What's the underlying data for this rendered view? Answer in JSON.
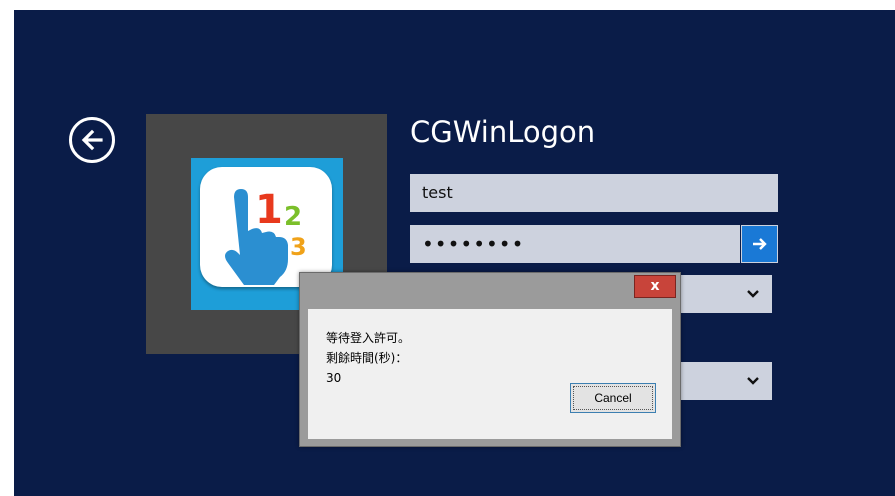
{
  "login": {
    "title": "CGWinLogon",
    "username_value": "test",
    "password_masked": "••••••••"
  },
  "icons": {
    "back": "back-arrow-icon",
    "submit": "arrow-right-icon",
    "dropdown": "chevron-down-icon",
    "app": "hand-123-app-icon"
  },
  "dialog": {
    "close_label": "x",
    "line1": "等待登入許可。",
    "line2": "剩餘時間(秒)：",
    "countdown": "30",
    "cancel_label": "Cancel"
  },
  "colors": {
    "background": "#0a1c48",
    "tile": "#474747",
    "field": "#cdd2de",
    "accent": "#1a79d6",
    "close": "#c8443a"
  }
}
